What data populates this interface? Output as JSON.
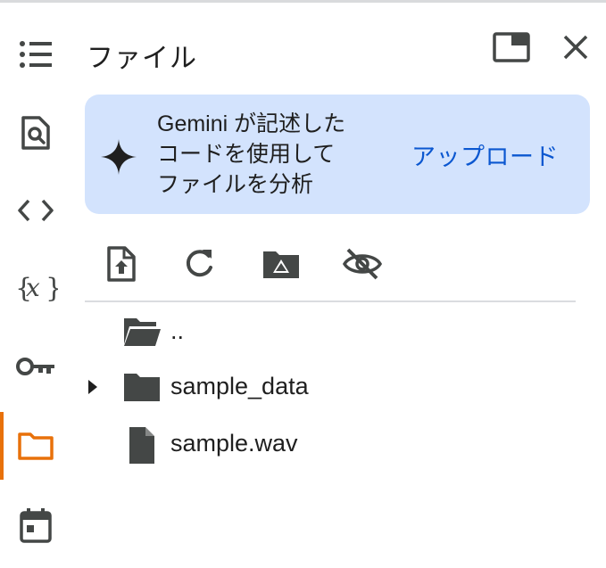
{
  "panel": {
    "title": "ファイル"
  },
  "sidebar": {
    "items": [
      {
        "icon": "table-of-contents-icon"
      },
      {
        "icon": "find-replace-icon"
      },
      {
        "icon": "code-snippets-icon"
      },
      {
        "icon": "variables-icon"
      },
      {
        "icon": "secrets-key-icon"
      },
      {
        "icon": "folder-icon",
        "active": true
      },
      {
        "icon": "calendar-icon"
      }
    ]
  },
  "banner": {
    "text": "Gemini が記述した\nコードを使用して\nファイルを分析",
    "upload_label": "アップロード"
  },
  "toolbar": {
    "buttons": [
      "upload-file-icon",
      "refresh-icon",
      "mount-drive-icon",
      "hide-hidden-files-icon"
    ]
  },
  "files": [
    {
      "name": "..",
      "type": "parent-folder"
    },
    {
      "name": "sample_data",
      "type": "folder",
      "expandable": true
    },
    {
      "name": "sample.wav",
      "type": "file"
    }
  ],
  "colors": {
    "accent": "#e8710a",
    "banner_bg": "#d3e3fd",
    "link": "#0b57d0",
    "icon": "#444746"
  }
}
